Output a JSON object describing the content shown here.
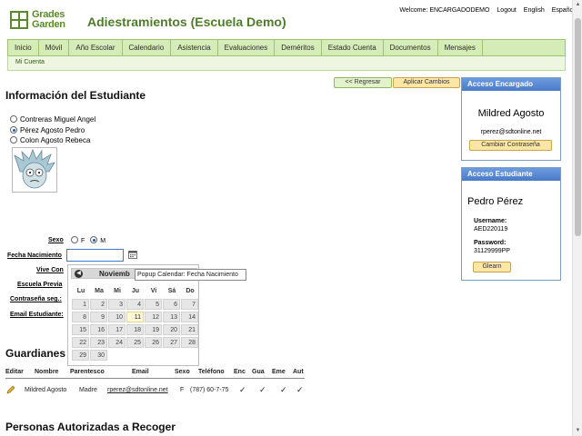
{
  "header": {
    "logo_line1": "Grades",
    "logo_line2": "Garden",
    "app_title": "Adiestramientos (Escuela Demo)",
    "welcome": "Welcome: ENCARGADODEMO",
    "logout": "Logout",
    "lang_en": "English",
    "lang_es": "Español"
  },
  "nav": {
    "items": [
      "Inicio",
      "Móvil",
      "Año Escolar",
      "Calendario",
      "Asistencia",
      "Evaluaciones",
      "Deméritos",
      "Estado Cuenta",
      "Documentos",
      "Mensajes"
    ],
    "sub_item": "Mi Cuenta"
  },
  "buttons": {
    "back": "<< Regresar",
    "apply": "Aplicar Cambios"
  },
  "student_section": {
    "title": "Información del Estudiante",
    "students": [
      {
        "name": "Contreras Miguel Angel",
        "selected": false
      },
      {
        "name": "Pérez Agosto Pedro",
        "selected": true
      },
      {
        "name": "Colon Agosto Rebeca",
        "selected": false
      }
    ]
  },
  "form": {
    "sexo_label": "Sexo",
    "sexo_f": "F",
    "sexo_m": "M",
    "fecha_label": "Fecha Nacimiento",
    "fecha_value": "",
    "vive_label": "Vive Con",
    "escuela_label": "Escuela Previa",
    "password_label": "Contraseña seg.:",
    "email_label": "Email Estudiante:"
  },
  "calendar": {
    "month_label": "Noviemb",
    "tooltip": "Popup Calendar: Fecha Nacimiento",
    "dow": [
      "Lu",
      "Ma",
      "Mi",
      "Ju",
      "Vi",
      "Sá",
      "Do"
    ],
    "weeks": [
      [
        "1",
        "2",
        "3",
        "4",
        "5",
        "6",
        "7"
      ],
      [
        "8",
        "9",
        "10",
        "11",
        "12",
        "13",
        "14"
      ],
      [
        "15",
        "16",
        "17",
        "18",
        "19",
        "20",
        "21"
      ],
      [
        "22",
        "23",
        "24",
        "25",
        "26",
        "27",
        "28"
      ],
      [
        "29",
        "30",
        "",
        "",
        "",
        "",
        ""
      ]
    ],
    "today": "11"
  },
  "guardians": {
    "title": "Guardianes",
    "columns": [
      "Editar",
      "Nombre",
      "Parentesco",
      "Email",
      "Sexo",
      "Teléfono",
      "Enc",
      "Gua",
      "Eme",
      "Aut"
    ],
    "rows": [
      {
        "nombre": "Mildred Agosto",
        "parentesco": "Madre",
        "email": "rperez@sdtonline.net",
        "sexo": "F",
        "telefono": "(787) 60-7-75",
        "checks": [
          "✓",
          "✓",
          "✓",
          "✓"
        ]
      }
    ]
  },
  "authorized_section": {
    "title": "Personas Autorizadas a Recoger"
  },
  "panel_encargado": {
    "title": "Acceso Encargado",
    "name": "Mildred Agosto",
    "email": "rperez@sdtonline.net",
    "button": "Cambiar Contraseña"
  },
  "panel_estudiante": {
    "title": "Acceso Estudiante",
    "name": "Pedro Pérez",
    "username_label": "Username:",
    "username": "AED220119",
    "password_label": "Password:",
    "password": "31129999PP",
    "button": "Glearn"
  },
  "colors": {
    "brand_green": "#4e7c2a",
    "nav_bg": "#d6ecb8",
    "panel_header": "#5a8ad6",
    "button_bg": "#fbe6a6"
  }
}
